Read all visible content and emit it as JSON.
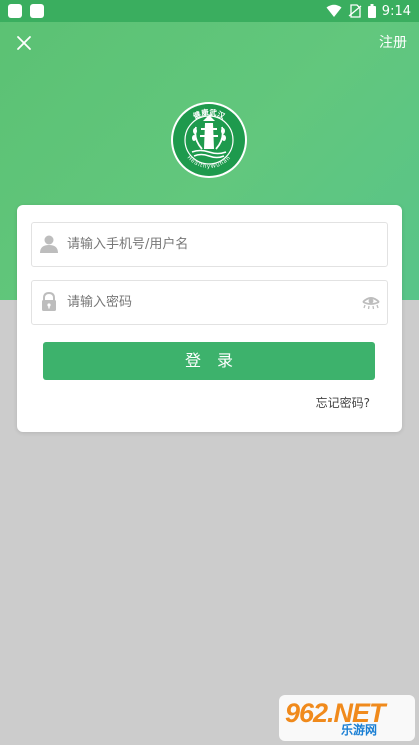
{
  "status_bar": {
    "time": "9:14",
    "icons": [
      "wifi-icon",
      "no-sim-icon",
      "battery-icon"
    ]
  },
  "header": {
    "close_icon": "close-icon",
    "register_label": "注册"
  },
  "logo": {
    "top_text": "健康武汉",
    "bottom_text": "HealthyWuhan"
  },
  "login_form": {
    "username_placeholder": "请输入手机号/用户名",
    "password_placeholder": "请输入密码",
    "login_button_label": "登录",
    "forgot_password_label": "忘记密码?"
  },
  "watermark": {
    "brand": "962.NET",
    "sub": "乐游网"
  },
  "colors": {
    "primary": "#3db26c",
    "status_bar": "#3aae5f",
    "page_background": "#cccccc"
  }
}
